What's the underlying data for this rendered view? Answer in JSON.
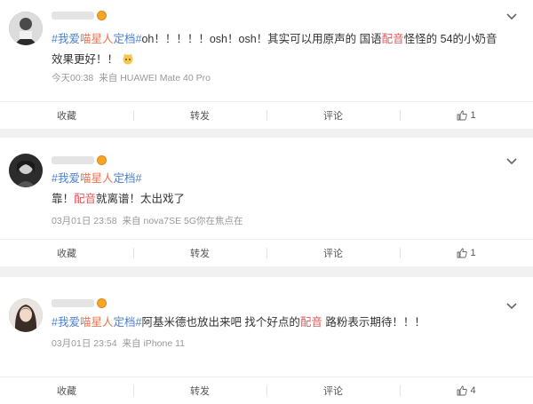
{
  "posts": [
    {
      "user_name": "",
      "hashtag": {
        "open": "#我爱",
        "highlight": "喵星人",
        "rest": "定档",
        "close": "#"
      },
      "content_before": "oh！！！！！osh！osh！其实可以用原声的 国语",
      "content_highlight": "配音",
      "content_after": "怪怪的 54的小奶音效果更好！！",
      "time": "今天00:38",
      "source": "来自 HUAWEI Mate 40 Pro",
      "actions": {
        "collect": "收藏",
        "repost": "转发",
        "comment": "评论",
        "likes": "1"
      }
    },
    {
      "user_name": "",
      "hashtag": {
        "open": "#我爱",
        "highlight": "喵星人",
        "rest": "定档",
        "close": "#"
      },
      "content_before": "靠！",
      "content_highlight": "配音",
      "content_after": "就离谱！太出戏了",
      "time": "03月01日 23:58",
      "source": "来自 nova7SE 5G你在焦点在",
      "actions": {
        "collect": "收藏",
        "repost": "转发",
        "comment": "评论",
        "likes": "1"
      }
    },
    {
      "user_name": "",
      "hashtag": {
        "open": "#我爱",
        "highlight": "喵星人",
        "rest": "定档",
        "close": "#"
      },
      "content_before": "阿基米德也放出来吧 找个好点的",
      "content_highlight": "配音",
      "content_after": " 路粉表示期待！！！",
      "time": "03月01日 23:54",
      "source": "来自 iPhone 11",
      "actions": {
        "collect": "收藏",
        "repost": "转发",
        "comment": "评论",
        "likes": "4"
      }
    }
  ],
  "colors": {
    "hashtag": "#4e7fc9",
    "highlight": "#e0565b",
    "meta": "#999999",
    "background": "#f1f1f1"
  }
}
